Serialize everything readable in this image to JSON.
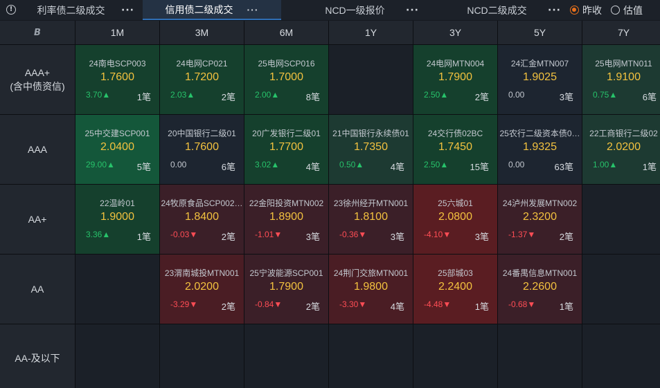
{
  "tabs": [
    {
      "label": "利率债二级成交",
      "active": false
    },
    {
      "label": "信用债二级成交",
      "active": true
    },
    {
      "label": "NCD一级报价",
      "active": false
    },
    {
      "label": "NCD二级成交",
      "active": false
    }
  ],
  "more_glyph": "···",
  "radios": [
    {
      "label": "昨收",
      "checked": true
    },
    {
      "label": "估值",
      "checked": false
    }
  ],
  "corner_icon": "B",
  "columns": [
    "1M",
    "3M",
    "6M",
    "1Y",
    "3Y",
    "5Y",
    "7Y"
  ],
  "rows": [
    {
      "label_line1": "AAA+",
      "label_line2": "(含中债资信)"
    },
    {
      "label_line1": "AAA",
      "label_line2": ""
    },
    {
      "label_line1": "AA+",
      "label_line2": ""
    },
    {
      "label_line1": "AA",
      "label_line2": ""
    },
    {
      "label_line1": "AA-及以下",
      "label_line2": ""
    }
  ],
  "cells": [
    [
      {
        "name": "24南电SCP003",
        "price": "1.7600",
        "change": "3.70▲",
        "dir": "up",
        "count": "1笔",
        "shade": "g1"
      },
      {
        "name": "24电网CP021",
        "price": "1.7200",
        "change": "2.03▲",
        "dir": "up",
        "count": "2笔",
        "shade": "g1"
      },
      {
        "name": "25电网SCP016",
        "price": "1.7000",
        "change": "2.00▲",
        "dir": "up",
        "count": "8笔",
        "shade": "g1"
      },
      null,
      {
        "name": "24电网MTN004",
        "price": "1.7900",
        "change": "2.50▲",
        "dir": "up",
        "count": "2笔",
        "shade": "g1"
      },
      {
        "name": "24汇金MTN007",
        "price": "1.9025",
        "change": "0.00",
        "dir": "flat",
        "count": "3笔",
        "shade": "n0"
      },
      {
        "name": "25电网MTN011",
        "price": "1.9100",
        "change": "0.75▲",
        "dir": "up",
        "count": "6笔",
        "shade": "g0"
      }
    ],
    [
      {
        "name": "25中交建SCP001",
        "price": "2.0400",
        "change": "29.00▲",
        "dir": "up",
        "count": "5笔",
        "shade": "g2"
      },
      {
        "name": "20中国银行二级01",
        "price": "1.7600",
        "change": "0.00",
        "dir": "flat",
        "count": "6笔",
        "shade": "n0"
      },
      {
        "name": "20广发银行二级01",
        "price": "1.7700",
        "change": "3.02▲",
        "dir": "up",
        "count": "4笔",
        "shade": "g1"
      },
      {
        "name": "21中国银行永续债01",
        "price": "1.7350",
        "change": "0.50▲",
        "dir": "up",
        "count": "4笔",
        "shade": "g0"
      },
      {
        "name": "24交行债02BC",
        "price": "1.7450",
        "change": "2.50▲",
        "dir": "up",
        "count": "15笔",
        "shade": "g1"
      },
      {
        "name": "25农行二级资本债0…",
        "price": "1.9325",
        "change": "0.00",
        "dir": "flat",
        "count": "63笔",
        "shade": "n0"
      },
      {
        "name": "22工商银行二级02",
        "price": "2.0200",
        "change": "1.00▲",
        "dir": "up",
        "count": "1笔",
        "shade": "g0"
      }
    ],
    [
      {
        "name": "22温岭01",
        "price": "1.9000",
        "change": "3.36▲",
        "dir": "up",
        "count": "1笔",
        "shade": "g1"
      },
      {
        "name": "24牧原食品SCP002…",
        "price": "1.8400",
        "change": "-0.03▼",
        "dir": "down",
        "count": "2笔",
        "shade": "r1"
      },
      {
        "name": "22金阳投资MTN002",
        "price": "1.8900",
        "change": "-1.01▼",
        "dir": "down",
        "count": "3笔",
        "shade": "r1"
      },
      {
        "name": "23徐州经开MTN001",
        "price": "1.8100",
        "change": "-0.36▼",
        "dir": "down",
        "count": "3笔",
        "shade": "r1"
      },
      {
        "name": "25六城01",
        "price": "2.0800",
        "change": "-4.10▼",
        "dir": "down",
        "count": "3笔",
        "shade": "r3"
      },
      {
        "name": "24泸州发展MTN002",
        "price": "2.3200",
        "change": "-1.37▼",
        "dir": "down",
        "count": "2笔",
        "shade": "r1"
      },
      null
    ],
    [
      null,
      {
        "name": "23渭南城投MTN001",
        "price": "2.0200",
        "change": "-3.29▼",
        "dir": "down",
        "count": "2笔",
        "shade": "r2"
      },
      {
        "name": "25宁波能源SCP001",
        "price": "1.7900",
        "change": "-0.84▼",
        "dir": "down",
        "count": "2笔",
        "shade": "r1"
      },
      {
        "name": "24荆门交旅MTN001",
        "price": "1.9800",
        "change": "-3.30▼",
        "dir": "down",
        "count": "4笔",
        "shade": "r2"
      },
      {
        "name": "25部城03",
        "price": "2.2400",
        "change": "-4.48▼",
        "dir": "down",
        "count": "1笔",
        "shade": "r3"
      },
      {
        "name": "24番禺信息MTN001",
        "price": "2.2600",
        "change": "-0.68▼",
        "dir": "down",
        "count": "1笔",
        "shade": "r1"
      },
      null
    ],
    [
      null,
      null,
      null,
      null,
      null,
      null,
      null
    ]
  ]
}
